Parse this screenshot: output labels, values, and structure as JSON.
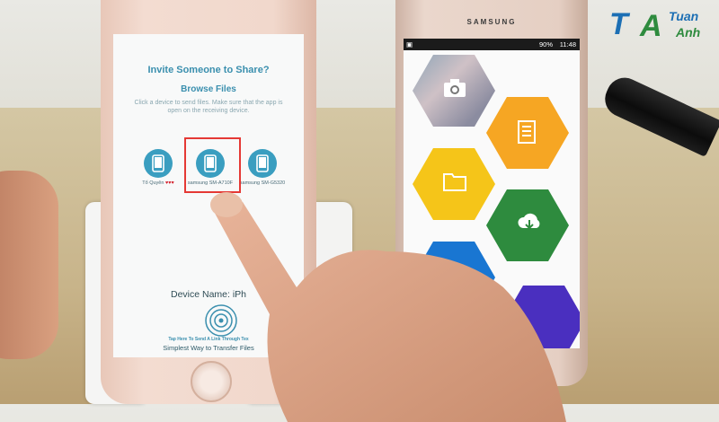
{
  "iphone": {
    "share_title": "Invite Someone to Share?",
    "browse_label": "Browse Files",
    "hint": "Click a device to send files. Make sure that the app is open on the receiving device.",
    "devices": [
      {
        "label": "Tổ Quyên",
        "hearts": "♥♥♥"
      },
      {
        "label": "samsung SM-A710F"
      },
      {
        "label": "samsung SM-G5320"
      }
    ],
    "device_name_label": "Device Name: iPh",
    "tap_hint": "Tap Here To Send A Link Through Tex",
    "tagline": "Simplest Way to Transfer Files"
  },
  "samsung": {
    "brand": "SAMSUNG",
    "status": {
      "battery": "90%",
      "time": "11:48"
    },
    "tiles": [
      {
        "icon": "camera-icon",
        "color": "#8fa5b7"
      },
      {
        "icon": "notes-icon",
        "color": "#f6a623"
      },
      {
        "icon": "folder-icon",
        "color": "#f5c519"
      },
      {
        "icon": "cloud-download-icon",
        "color": "#2e8b3e"
      },
      {
        "icon": "document-icon",
        "color": "#1976d2"
      },
      {
        "icon": "purple-tile",
        "color": "#4a2fbf"
      }
    ]
  },
  "logo": {
    "letters_1": "T",
    "letters_2": "A",
    "word_1": "Tuan",
    "word_2": "Anh"
  },
  "accent": {
    "highlight": "#e53935",
    "app_blue": "#3a9ec0"
  }
}
